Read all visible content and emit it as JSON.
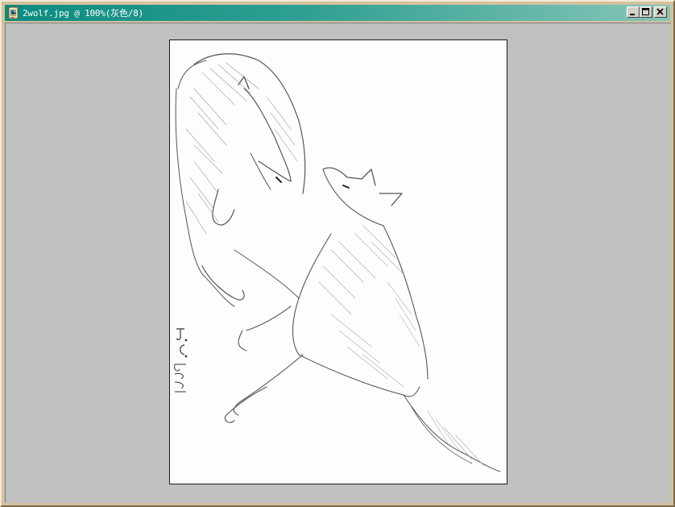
{
  "window": {
    "title": "2wolf.jpg @ 100%(灰色/8)"
  },
  "icons": {
    "app": "photoshop-document-icon",
    "minimize": "minimize-icon",
    "maximize": "maximize-icon",
    "close": "close-icon"
  },
  "artwork": {
    "subject": "pencil sketch of two wolves",
    "signature_initials": "J.C.",
    "signature_year": "2008"
  },
  "colors": {
    "titlebar_start": "#0b8b80",
    "titlebar_end": "#86c6b7",
    "workspace": "#c0c0c0",
    "frame": "#d4c19f"
  }
}
